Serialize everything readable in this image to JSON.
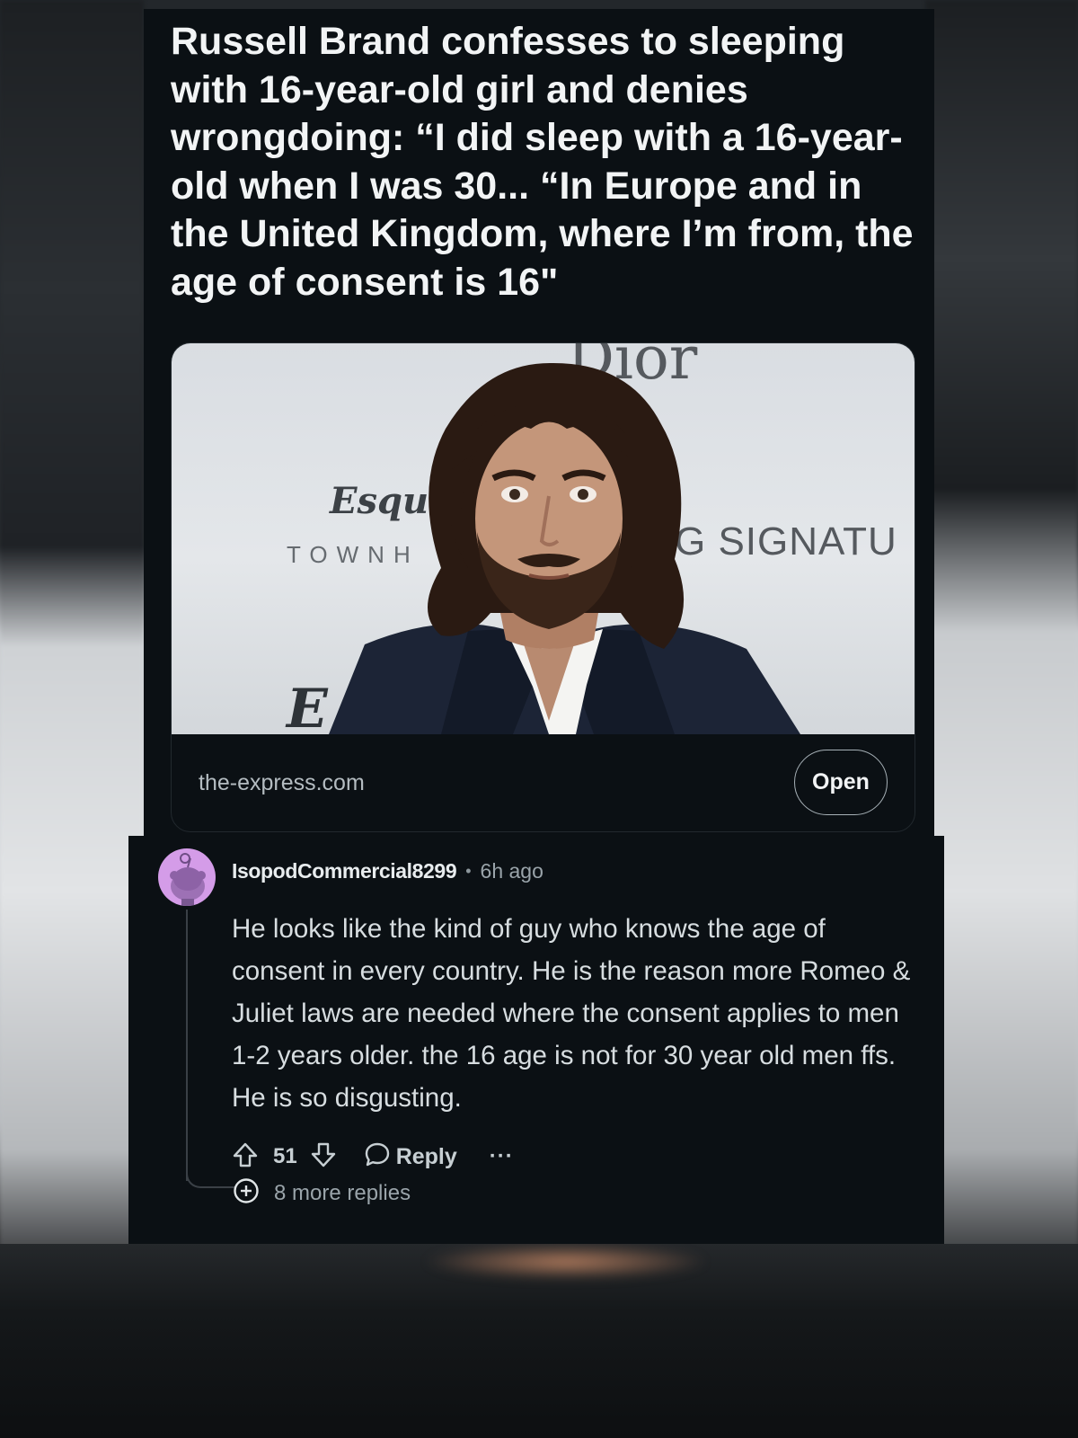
{
  "post": {
    "title": "Russell Brand confesses to sleeping with 16-year-old girl and denies wrongdoing: “I did sleep with a 16-year-old when I was 30... “In Europe and in the United Kingdom, where I’m from, the age of consent is 16\"",
    "link": {
      "domain": "the-express.com",
      "open_label": "Open",
      "image_backdrop": {
        "brand_top": "Dior",
        "brand_left": "Esqui",
        "sub_left": "TOWNH",
        "right_text": "G SIGNATU",
        "bottom_left": "E"
      }
    }
  },
  "comment": {
    "username": "IsopodCommercial8299",
    "separator": "•",
    "time": "6h ago",
    "body": "He looks like the kind of guy who knows the age of consent in every country. He is the reason more Romeo & Juliet laws are needed where the consent applies to men 1-2 years older. the 16 age is not for 30 year old men ffs. He is so disgusting.",
    "vote_count": "51",
    "reply_label": "Reply",
    "more_label": "···",
    "more_replies_label": "8 more replies"
  },
  "icons": {
    "upvote": "upvote-arrow-icon",
    "downvote": "downvote-arrow-icon",
    "reply": "speech-bubble-icon",
    "expand": "plus-circle-icon",
    "avatar": "reddit-snoo-avatar-icon"
  },
  "colors": {
    "card_background": "#0b1014",
    "avatar_background": "#d49ce8",
    "title_text": "#f2f4f5",
    "meta_text": "#9aa4aa"
  }
}
